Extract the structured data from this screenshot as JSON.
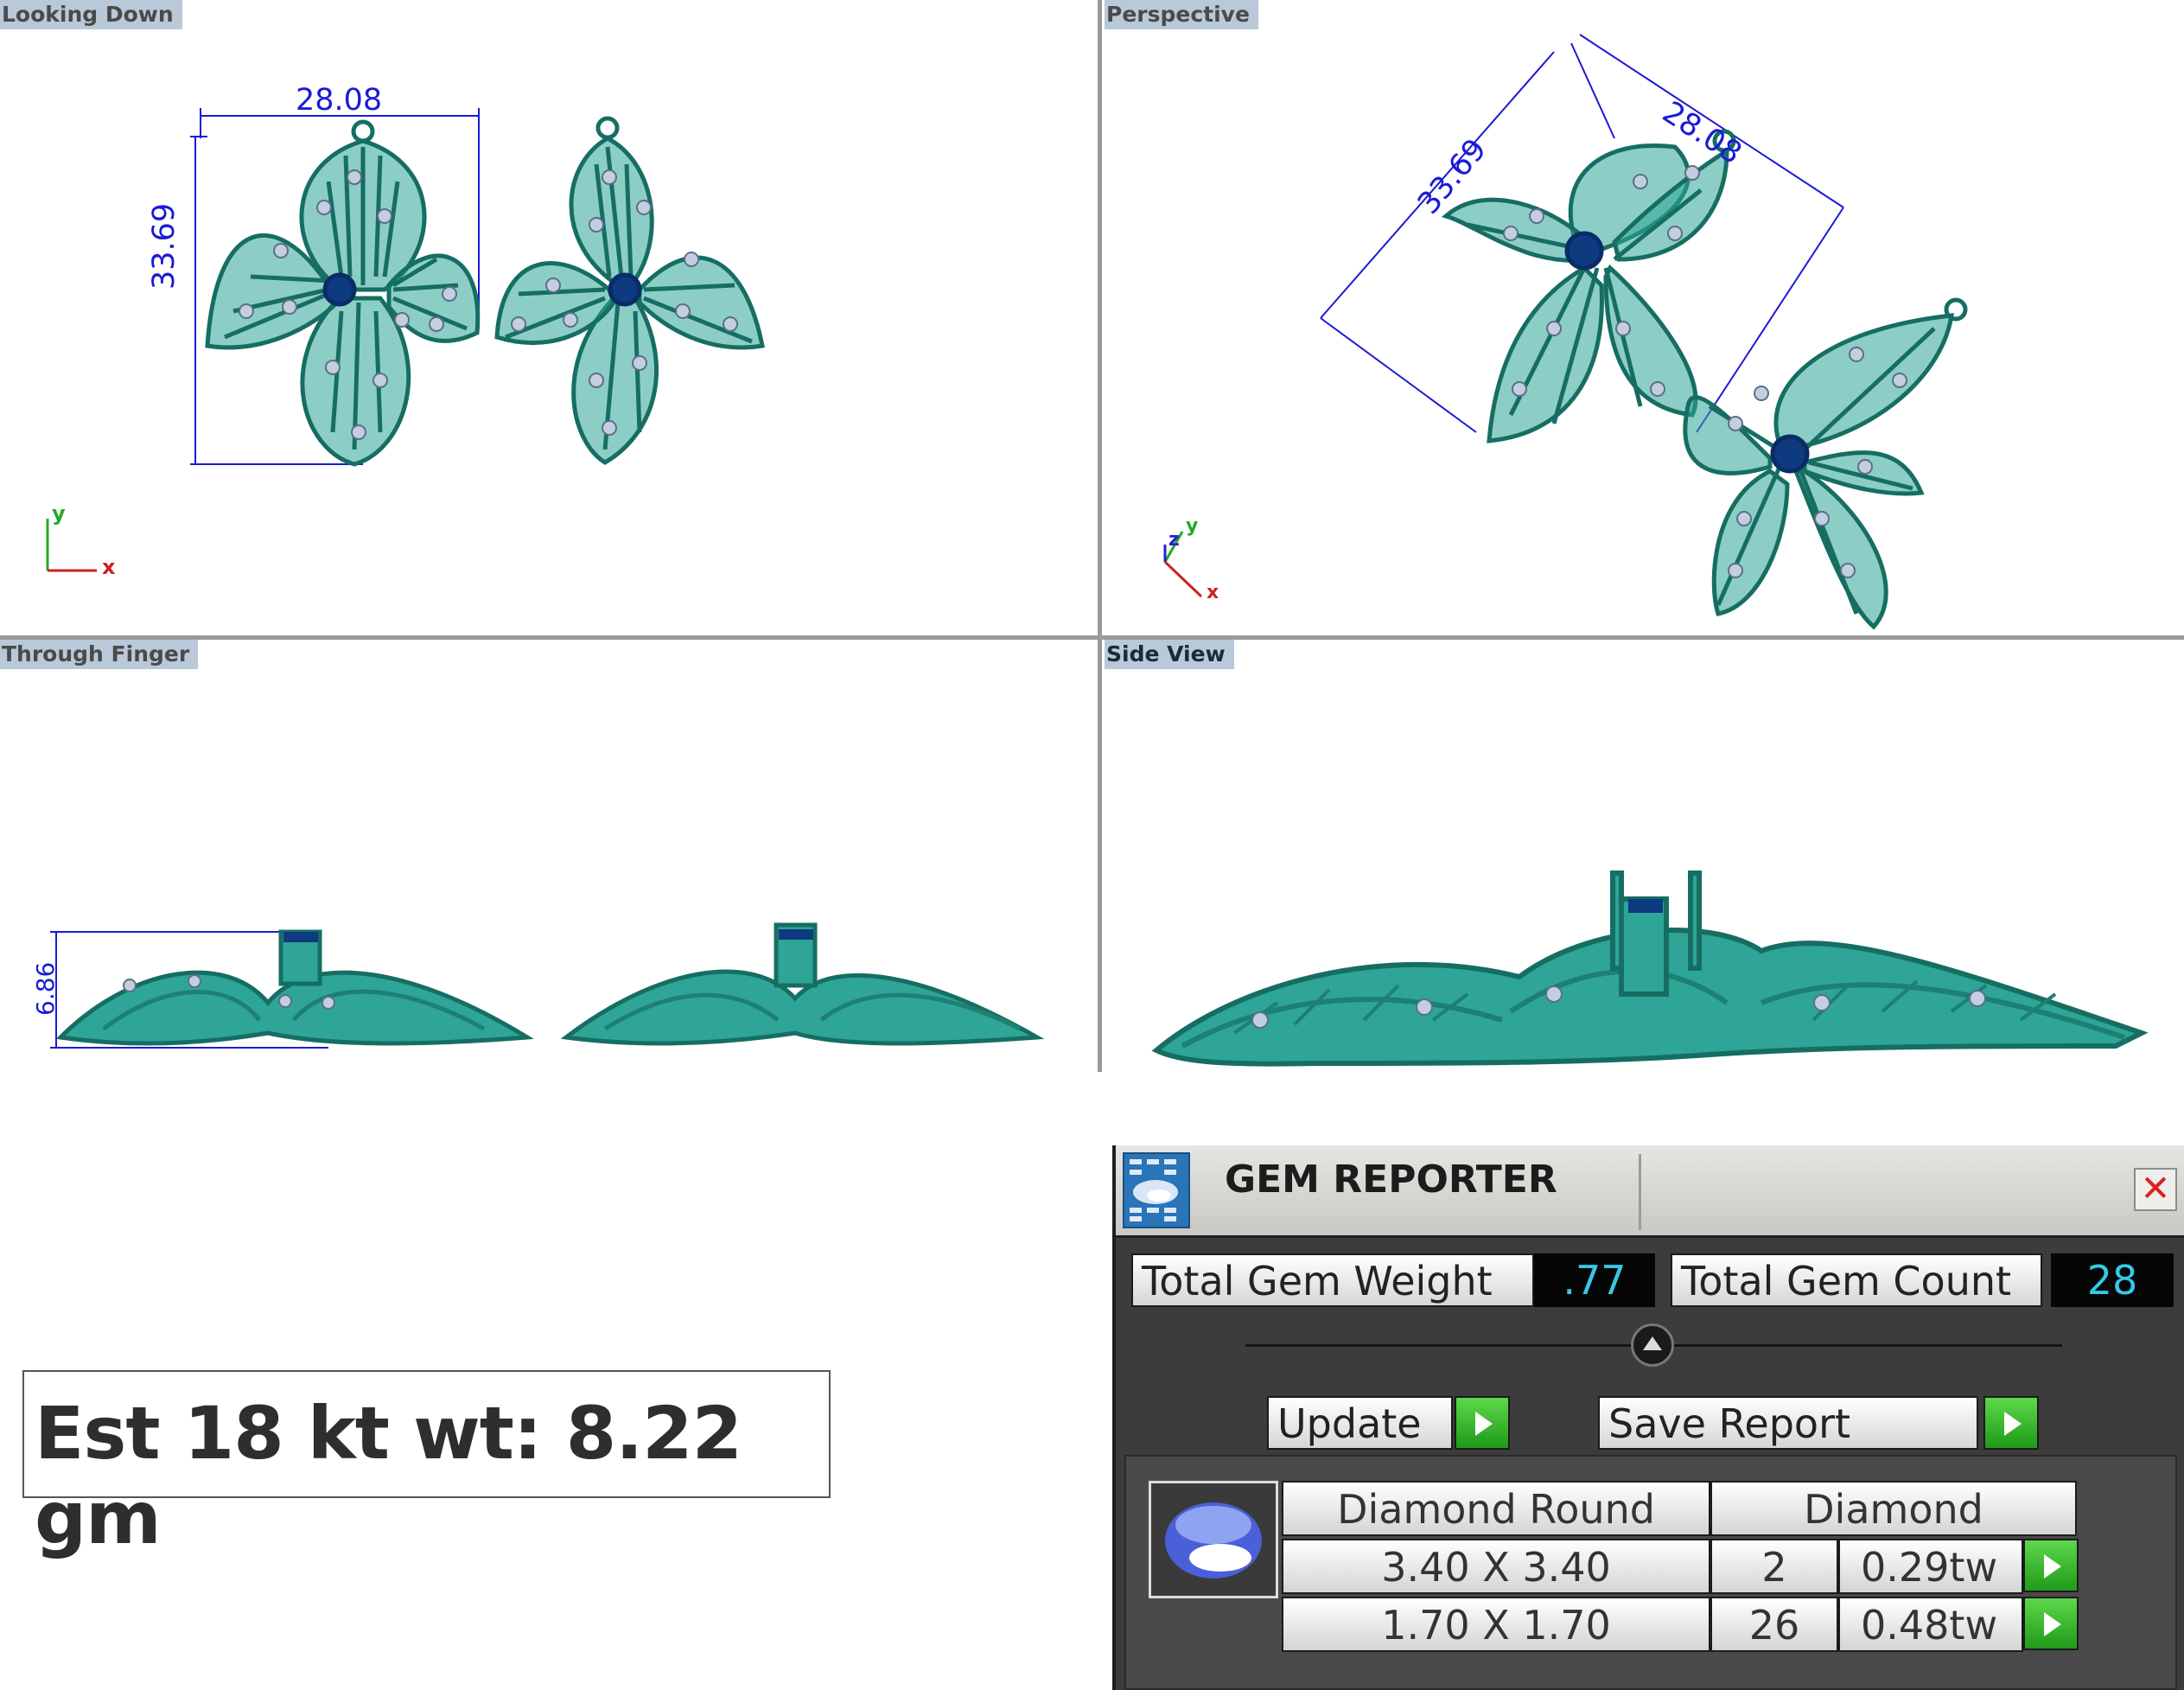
{
  "viewports": {
    "top_left": {
      "title": "Looking Down",
      "width_dim": "28.08",
      "height_dim": "33.69",
      "axis_y": "y",
      "axis_x": "x"
    },
    "top_right": {
      "title": "Perspective",
      "width_dim": "28.08",
      "height_dim": "33.69",
      "axis_z": "z",
      "axis_y": "y",
      "axis_x": "x"
    },
    "bottom_left": {
      "title": "Through Finger",
      "height_dim": "6.86"
    },
    "bottom_right": {
      "title": "Side View"
    }
  },
  "weight_note": "Est 18 kt wt: 8.22 gm",
  "gem_reporter": {
    "title": "GEM REPORTER",
    "total_weight_label": "Total Gem Weight",
    "total_weight_value": ".77",
    "total_count_label": "Total Gem Count",
    "total_count_value": "28",
    "update_label": "Update",
    "save_label": "Save Report",
    "table": {
      "shape": "Diamond Round",
      "material": "Diamond",
      "rows": [
        {
          "size": "3.40 X 3.40",
          "count": "2",
          "weight": "0.29tw"
        },
        {
          "size": "1.70 X 1.70",
          "count": "26",
          "weight": "0.48tw"
        }
      ]
    }
  },
  "colors": {
    "metal": "#2ea596",
    "metal_highlight": "#4fd6c4",
    "dimension": "#1a1ad6",
    "viewport_title_bg": "#b9c9d9",
    "panel_bg": "#3c3c3c",
    "value_text": "#36c8e8",
    "go_button": "#2fb82a"
  }
}
